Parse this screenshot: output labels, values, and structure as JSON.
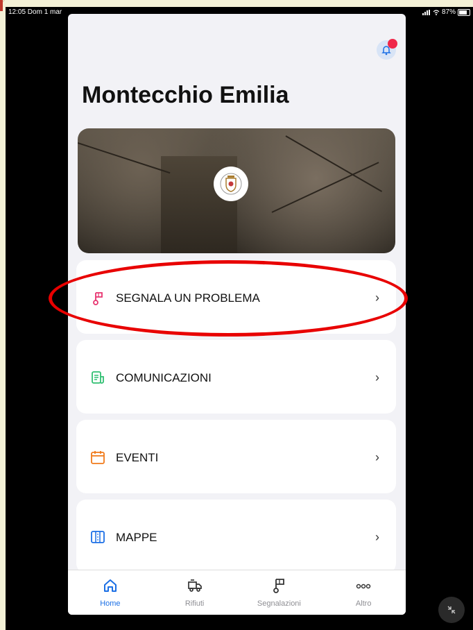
{
  "status_bar": {
    "time": "12:05  Dom 1 mar",
    "battery": "87%"
  },
  "header": {
    "title": "Montecchio Emilia",
    "notification_icon": "bell-icon"
  },
  "hero": {
    "logo_icon": "coat-of-arms-icon"
  },
  "menu": [
    {
      "label": "SEGNALA UN PROBLEMA",
      "icon": "flag-pin-icon",
      "color": "#e8336f"
    },
    {
      "label": "COMUNICAZIONI",
      "icon": "document-icon",
      "color": "#2fbf71"
    },
    {
      "label": "EVENTI",
      "icon": "calendar-icon",
      "color": "#f07a1a"
    },
    {
      "label": "MAPPE",
      "icon": "map-icon",
      "color": "#1b6fe5"
    }
  ],
  "tabbar": [
    {
      "label": "Home",
      "icon": "home-icon",
      "active": true
    },
    {
      "label": "Rifiuti",
      "icon": "garbage-truck-icon",
      "active": false
    },
    {
      "label": "Segnalazioni",
      "icon": "flag-pin-icon",
      "active": false
    },
    {
      "label": "Altro",
      "icon": "more-icon",
      "active": false
    }
  ],
  "colors": {
    "accent": "#1b6fe5",
    "annotation": "#e80000",
    "notification_dot": "#f0284a"
  }
}
